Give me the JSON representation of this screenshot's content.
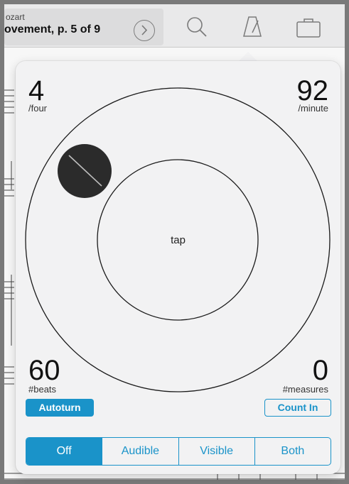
{
  "header": {
    "composer_partial": "ozart",
    "title_partial": "ovement, p. 5 of 9"
  },
  "toolbar": {
    "icons": [
      "chevron-right-circle-icon",
      "search-icon",
      "metronome-icon",
      "briefcase-icon"
    ]
  },
  "metronome": {
    "beats_per_measure": "4",
    "beats_per_measure_label": "/four",
    "tempo": "92",
    "tempo_label": "/minute",
    "tap_label": "tap",
    "beats_count": "60",
    "beats_count_label": "#beats",
    "measures_count": "0",
    "measures_count_label": "#measures",
    "autoturn_label": "Autoturn",
    "count_in_label": "Count In",
    "modes": [
      {
        "label": "Off",
        "selected": true
      },
      {
        "label": "Audible",
        "selected": false
      },
      {
        "label": "Visible",
        "selected": false
      },
      {
        "label": "Both",
        "selected": false
      }
    ]
  },
  "colors": {
    "accent": "#1a93c9",
    "knob": "#2b2b2b"
  }
}
